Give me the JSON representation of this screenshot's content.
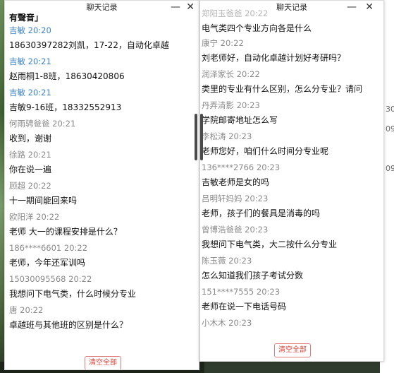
{
  "left_window": {
    "title": "聊天记录",
    "min_glyph": "—",
    "close_glyph": "✕",
    "top_partial_text": "有聲音」",
    "messages": [
      {
        "sender": "吉敏",
        "time": "20:20",
        "text": "18630397282刘凯，17-22，自动化卓越",
        "highlight": true
      },
      {
        "sender": "吉敏",
        "time": "20:21",
        "text": "赵雨桐1-8班，18630420806",
        "highlight": true
      },
      {
        "sender": "吉敏",
        "time": "20:21",
        "text": "吉敏9-16班，18332552913",
        "highlight": true
      },
      {
        "sender": "何雨骋爸爸",
        "time": "20:21",
        "text": "收到，谢谢",
        "highlight": false
      },
      {
        "sender": "徐路",
        "time": "20:21",
        "text": "你在说一遍",
        "highlight": false
      },
      {
        "sender": "顾超",
        "time": "20:22",
        "text": "十一期间能回来吗",
        "highlight": false
      },
      {
        "sender": "欧阳洋",
        "time": "20:22",
        "text": "老师 大一的课程安排是什么？",
        "highlight": false
      },
      {
        "sender": "186****6601",
        "time": "20:22",
        "text": "老师，今年还军训吗",
        "highlight": false
      },
      {
        "sender": "15030095568",
        "time": "20:22",
        "text": "我想问下电气类，什么时候分专业",
        "highlight": false
      },
      {
        "sender": "唐",
        "time": "20:22",
        "text": "卓越班与其他班的区别是什么？",
        "highlight": false
      }
    ],
    "clear_label": "清空全部"
  },
  "right_window": {
    "title": "聊天记录",
    "min_glyph": "—",
    "close_glyph": "✕",
    "top_partial_meta": "郑阳玉爸爸 20:22",
    "top_partial_text": "电气类四个专业方向各是什么",
    "messages": [
      {
        "sender": "康宁",
        "time": "20:22",
        "text": "刘老师好，自动化卓越计划好考研吗？"
      },
      {
        "sender": "润泽家长",
        "time": "20:22",
        "text": "类里的专业有什么区别，怎么分专业？请问"
      },
      {
        "sender": "丹弄清影",
        "time": "20:23",
        "text": "学院邮寄地址怎么写"
      },
      {
        "sender": "李松涛",
        "time": "20:23",
        "text": "老师您好，咱们什么时间分专业呢"
      },
      {
        "sender": "136****2766",
        "time": "20:23",
        "text": "吉敏老师是女的吗"
      },
      {
        "sender": "吕明轩妈妈",
        "time": "20:23",
        "text": "老师，孩子们的餐具是消毒的吗"
      },
      {
        "sender": "曾博浩爸爸",
        "time": "20:23",
        "text": "我想问下电气类，大二按什么分专业"
      },
      {
        "sender": "陈玉薇",
        "time": "20:23",
        "text": "怎么知道我们孩子考试分数"
      },
      {
        "sender": "151****7555",
        "time": "20:23",
        "text": "老师在说一下电话号码"
      },
      {
        "sender": "小木木",
        "time": "20:23",
        "text": ""
      }
    ],
    "clear_label": "清空全部"
  },
  "background": {
    "edge_texts": [
      "30",
      "09",
      "09"
    ]
  }
}
